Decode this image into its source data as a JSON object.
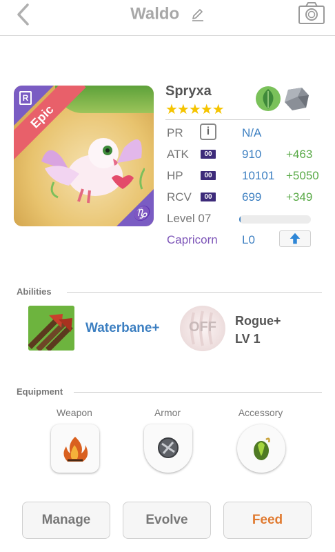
{
  "header": {
    "title": "Waldo"
  },
  "card": {
    "rarity": "Epic",
    "rarity_icon": "R",
    "sign_glyph": "♑"
  },
  "pet": {
    "name": "Spryxa",
    "stars": "★★★★★",
    "star_count": 5,
    "elements": [
      "nature-leaf-icon",
      "rock-icon"
    ]
  },
  "stats": {
    "pr": {
      "label": "PR",
      "value": "N/A"
    },
    "atk": {
      "label": "ATK",
      "badge": "00",
      "value": "910",
      "bonus": "+463"
    },
    "hp": {
      "label": "HP",
      "badge": "00",
      "value": "10101",
      "bonus": "+5050"
    },
    "rcv": {
      "label": "RCV",
      "badge": "00",
      "value": "699",
      "bonus": "+349"
    },
    "level": {
      "label": "Level 07",
      "xp_fraction": 0.02
    },
    "zodiac": {
      "label": "Capricorn",
      "value": "L0"
    }
  },
  "abilities": {
    "title": "Abilities",
    "active": "Waterbane+",
    "passive_state": "OFF",
    "passive_name": "Rogue+",
    "passive_level": "LV 1"
  },
  "equipment": {
    "title": "Equipment",
    "slots": [
      {
        "label": "Weapon"
      },
      {
        "label": "Armor"
      },
      {
        "label": "Accessory"
      }
    ]
  },
  "buttons": {
    "manage": "Manage",
    "evolve": "Evolve",
    "feed": "Feed"
  },
  "colors": {
    "accent_blue": "#3c7fc1",
    "bonus_green": "#5aaa48",
    "feed_orange": "#e07a30",
    "zodiac_purple": "#7d55b8"
  }
}
